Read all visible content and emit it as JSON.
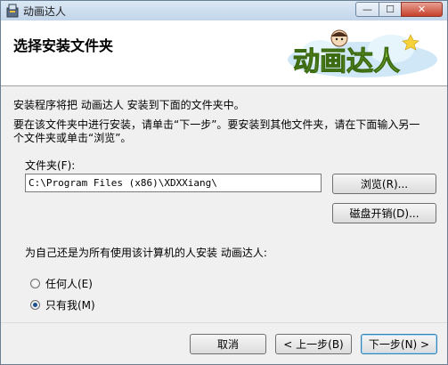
{
  "window": {
    "title": "动画达人",
    "minimize_glyph": "—",
    "maximize_glyph": "☐",
    "close_glyph": "✕"
  },
  "header": {
    "title": "选择安装文件夹",
    "logo_text": "动画达人"
  },
  "body": {
    "intro": "安装程序将把 动画达人 安装到下面的文件夹中。",
    "instruction_line1": "要在该文件夹中进行安装，请单击“下一步”。要安装到其他文件夹，请在下面输入另一",
    "instruction_line2": "个文件夹或单击“浏览”。"
  },
  "folder": {
    "label": "文件夹(F):",
    "path_value": "C:\\Program Files (x86)\\XDXXiang\\",
    "browse_label": "浏览(R)...",
    "disk_cost_label": "磁盘开销(D)..."
  },
  "install_for": {
    "question": "为自己还是为所有使用该计算机的人安装 动画达人:",
    "options": [
      {
        "label": "任何人(E)",
        "selected": false
      },
      {
        "label": "只有我(M)",
        "selected": true
      }
    ]
  },
  "footer": {
    "cancel_label": "取消",
    "back_label": "< 上一步(B)",
    "next_label": "下一步(N) >"
  },
  "colors": {
    "accent": "#3c7fb1",
    "close_button": "#c6402b"
  }
}
